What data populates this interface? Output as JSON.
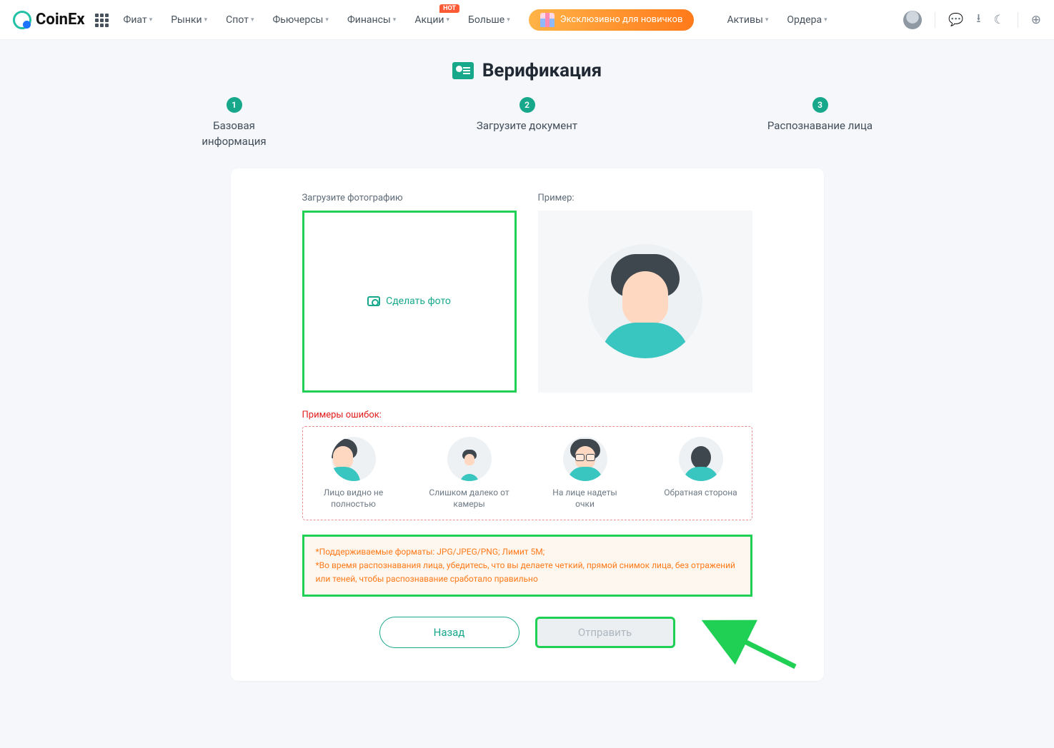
{
  "brand": "CoinEx",
  "nav": {
    "fiat": "Фиат",
    "markets": "Рынки",
    "spot": "Спот",
    "futures": "Фьючерсы",
    "finance": "Финансы",
    "promo_menu": "Акции",
    "more": "Больше",
    "assets": "Активы",
    "orders": "Ордера",
    "hot_badge": "HOT"
  },
  "promo_banner": "Эксклюзивно для новичков",
  "page_title": "Верификация",
  "steps": {
    "s1_num": "1",
    "s1": "Базовая информация",
    "s2_num": "2",
    "s2": "Загрузите документ",
    "s3_num": "3",
    "s3": "Распознавание лица"
  },
  "upload": {
    "label": "Загрузите фотографию",
    "action": "Сделать фото",
    "example_label": "Пример:"
  },
  "errors": {
    "title": "Примеры ошибок:",
    "e1": "Лицо видно не полностью",
    "e2": "Слишком далеко от камеры",
    "e3": "На лице надеты очки",
    "e4": "Обратная сторона"
  },
  "notice": {
    "line1": "*Поддерживаемые форматы: JPG/JPEG/PNG; Лимит 5M;",
    "line2": "*Во время распознавания лица, убедитесь, что вы делаете четкий, прямой снимок лица, без отражений или теней, чтобы распознавание сработало правильно"
  },
  "buttons": {
    "back": "Назад",
    "submit": "Отправить"
  }
}
